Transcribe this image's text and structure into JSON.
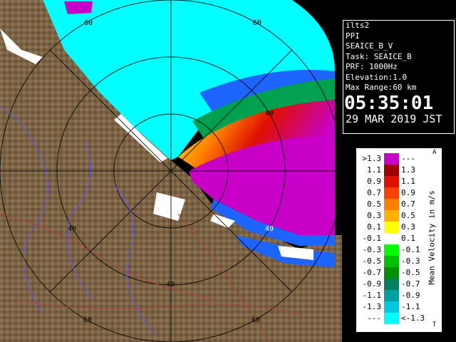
{
  "info": {
    "radar": "ilts2",
    "mode": "PPI",
    "product": "SEAICE_B_V",
    "task": "Task: SEAICE_B",
    "prf": "PRF: 1000Hz",
    "elevation": "Elevation:1.0",
    "max_range": "Max Range:60 km",
    "time": "05:35:01",
    "date": "29 MAR 2019 JST"
  },
  "legend": {
    "title": "Mean Velocity in m/s",
    "top_tick": "A",
    "bottom_tick": "T",
    "rows": [
      {
        "left": ">1.3",
        "right": "---",
        "color": "#c800c8"
      },
      {
        "left": "1.1",
        "right": "1.3",
        "color": "#a00000"
      },
      {
        "left": "0.9",
        "right": "1.1",
        "color": "#e01000"
      },
      {
        "left": "0.7",
        "right": "0.9",
        "color": "#ff4000"
      },
      {
        "left": "0.5",
        "right": "0.7",
        "color": "#ff8000"
      },
      {
        "left": "0.3",
        "right": "0.5",
        "color": "#ffb000"
      },
      {
        "left": "0.1",
        "right": "0.3",
        "color": "#ffff00"
      },
      {
        "left": "-0.1",
        "right": "0.1",
        "color": "#ffffff"
      },
      {
        "left": "-0.3",
        "right": "-0.1",
        "color": "#00ff00"
      },
      {
        "left": "-0.5",
        "right": "-0.3",
        "color": "#00c000"
      },
      {
        "left": "-0.7",
        "right": "-0.5",
        "color": "#009000"
      },
      {
        "left": "-0.9",
        "right": "-0.7",
        "color": "#008060"
      },
      {
        "left": "-1.1",
        "right": "-0.9",
        "color": "#00a0a0"
      },
      {
        "left": "-1.3",
        "right": "-1.1",
        "color": "#00c8e0"
      },
      {
        "left": "---",
        "right": "<-1.3",
        "color": "#00ffff"
      }
    ]
  },
  "rings": {
    "labels": [
      "40",
      "60"
    ]
  },
  "colors": {
    "land": "#806848",
    "sea_approach": "#00ffff",
    "sea_recede": "#c800c8",
    "ice_white": "#ffffff",
    "blue_band": "#1e64ff"
  }
}
